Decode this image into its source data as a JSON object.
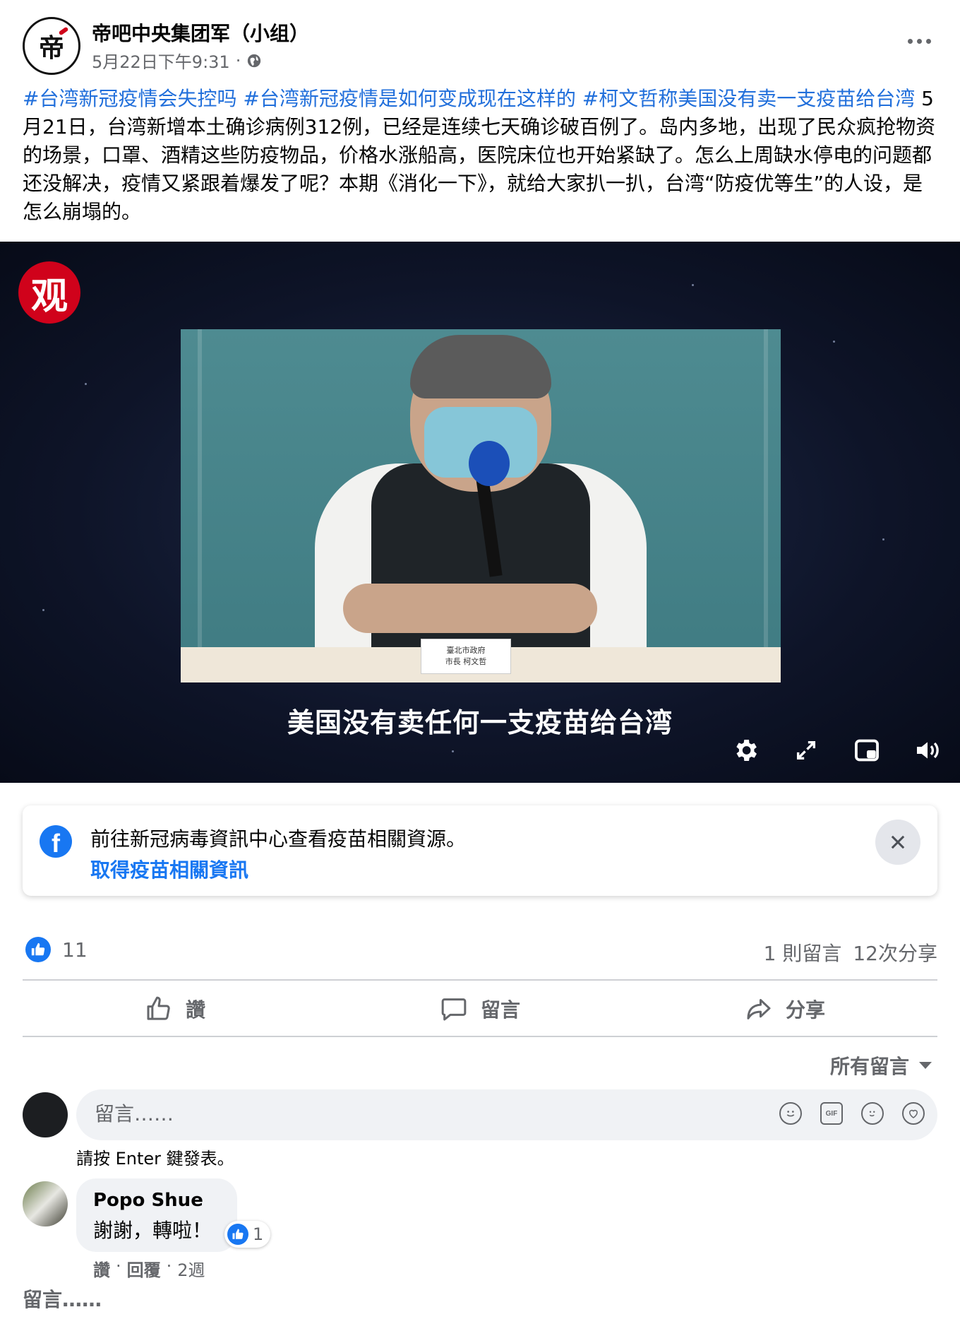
{
  "header": {
    "group_name": "帝吧中央集团军（小组）",
    "timestamp": "5月22日下午9:31",
    "separator": "·",
    "avatar_glyph": "帝"
  },
  "post": {
    "hashtags": [
      "#台湾新冠疫情会失控吗",
      "#台湾新冠疫情是如何变成现在这样的",
      "#柯文哲称美国没有卖一支疫苗给台湾"
    ],
    "body": " 5月21日，台湾新增本土确诊病例312例，已经是连续七天确诊破百例了。岛内多地，出现了民众疯抢物资的场景，口罩、酒精这些防疫物品，价格水涨船高，医院床位也开始紧缺了。怎么上周缺水停电的问题都还没解决，疫情又紧跟着爆发了呢？本期《消化一下》，就给大家扒一扒，台湾“防疫优等生”的人设，是怎么崩塌的。"
  },
  "video": {
    "channel_logo": "观",
    "subtitle": "美国没有卖任何一支疫苗给台湾",
    "nameplate_line1": "臺北市政府",
    "nameplate_line2": "市長 柯文哲",
    "controls": [
      "settings-icon",
      "fullscreen-icon",
      "miniplayer-icon",
      "volume-icon"
    ]
  },
  "info_card": {
    "text": "前往新冠病毒資訊中心查看疫苗相關資源。",
    "link": "取得疫苗相關資訊",
    "icon": "facebook-icon"
  },
  "reactions": {
    "count": "11",
    "comments": "1 則留言",
    "shares": "12次分享"
  },
  "actions": {
    "like": "讚",
    "comment": "留言",
    "share": "分享"
  },
  "comments": {
    "filter": "所有留言",
    "input_placeholder": "留言……",
    "enter_hint": "請按 Enter 鍵發表。",
    "items": [
      {
        "name": "Popo Shue",
        "text": "謝謝，轉啦！",
        "likes": "1",
        "like_action": "讚",
        "reply_action": "回覆",
        "age": "2週",
        "dot": "·"
      }
    ],
    "bottom_prompt": "留言……"
  },
  "colors": {
    "accent": "#1877f2",
    "hashtag": "#216fdb",
    "muted": "#65676b"
  }
}
